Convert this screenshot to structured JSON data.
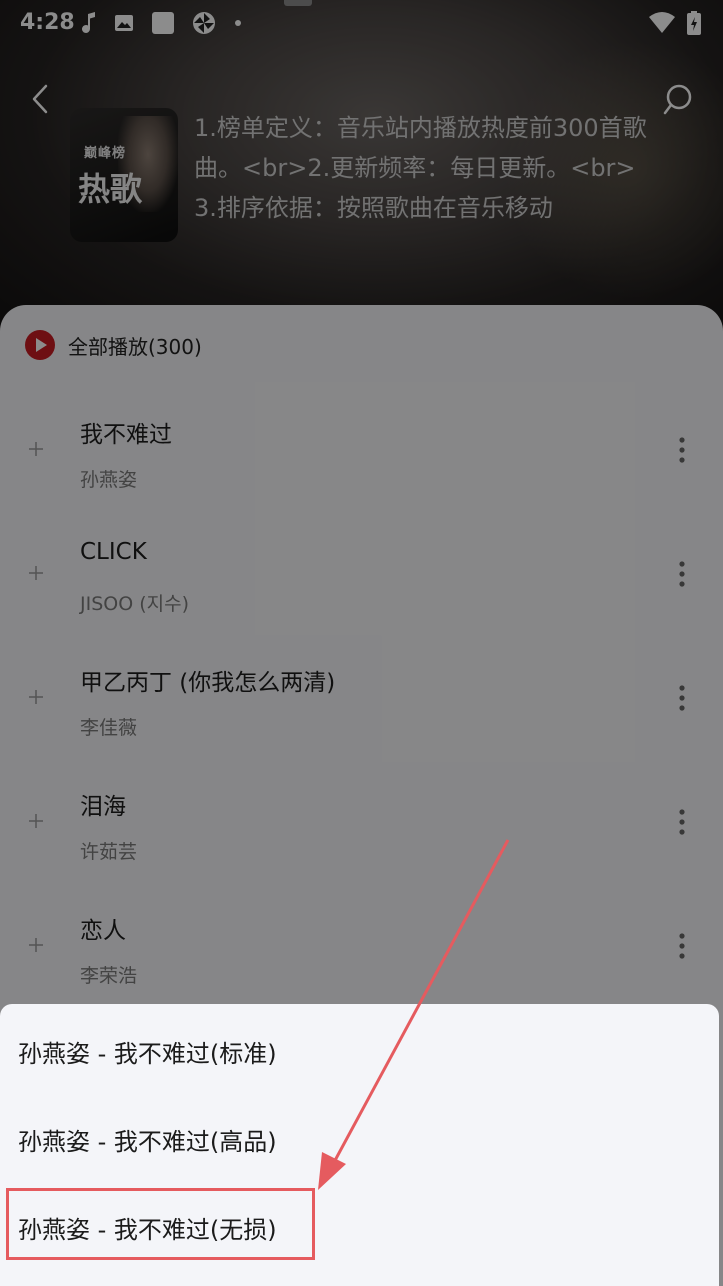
{
  "status_bar": {
    "time": "4:28",
    "left_icons": [
      "music-note-icon",
      "image-icon",
      "square-icon",
      "pinwheel-icon",
      "dot-icon"
    ],
    "right_icons": [
      "wifi-icon",
      "battery-icon"
    ]
  },
  "header": {
    "description": "1.榜单定义：音乐站内播放热度前300首歌曲。<br>2.更新频率：每日更新。<br>3.排序依据：按照歌曲在音乐移动",
    "cover_text_small": "巅峰榜",
    "cover_text_big": "热歌"
  },
  "list": {
    "play_all_label": "全部播放(300)",
    "songs": [
      {
        "title": "我不难过",
        "artist": "孙燕姿"
      },
      {
        "title": "CLICK",
        "artist": "JISOO (지수)"
      },
      {
        "title": "甲乙丙丁 (你我怎么两清)",
        "artist": "李佳薇"
      },
      {
        "title": "泪海",
        "artist": "许茹芸"
      },
      {
        "title": "恋人",
        "artist": "李荣浩"
      }
    ]
  },
  "quality_picker": {
    "options": [
      {
        "label": "孙燕姿 - 我不难过(标准)"
      },
      {
        "label": "孙燕姿 - 我不难过(高品)"
      },
      {
        "label": "孙燕姿 - 我不难过(无损)"
      }
    ]
  },
  "colors": {
    "accent_red": "#c81d24",
    "annotation_red": "#e55b5f"
  }
}
